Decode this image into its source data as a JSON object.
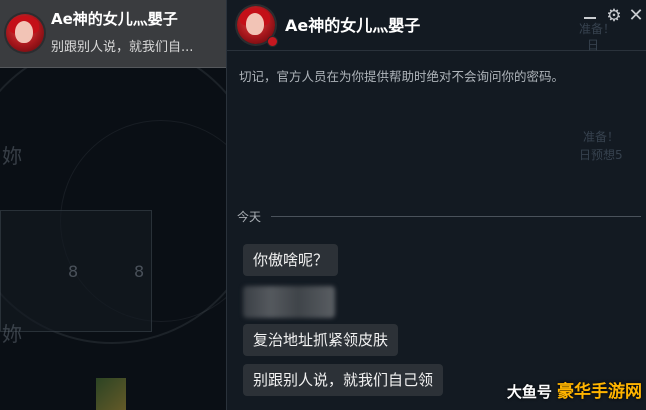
{
  "contact_list": {
    "items": [
      {
        "name": "Ae神的女儿灬嬰子",
        "last_message": "别跟别人说，就我们自..."
      }
    ]
  },
  "chat": {
    "title": "Ae神的女儿灬嬰子",
    "security_notice": "切记，官方人员在为你提供帮助时绝对不会询问你的密码。",
    "date_divider": "今天",
    "messages": [
      {
        "text": "你傲啥呢？",
        "obscured": false
      },
      {
        "text": "",
        "obscured": true
      },
      {
        "text": "复治地址抓紧领皮肤",
        "obscured": false
      },
      {
        "text": "别跟别人说，就我们自己领",
        "obscured": false
      }
    ],
    "controls": {
      "settings_icon": "⚙",
      "close_icon": "✕"
    }
  },
  "background": {
    "ghost_texts": [
      "准备！",
      "日",
      "准备！",
      "日预想5"
    ],
    "left_texts": [
      "妳",
      "妳"
    ],
    "left_numbers": [
      "8",
      "8"
    ]
  },
  "watermark": {
    "part_a": "大鱼号",
    "part_b": "豪华手游网"
  },
  "colors": {
    "avatar_red": "#c41018",
    "watermark_gold": "#ffb400",
    "selected_row_bg": "#3a3c3f",
    "bubble_bg": "#2c3137"
  }
}
